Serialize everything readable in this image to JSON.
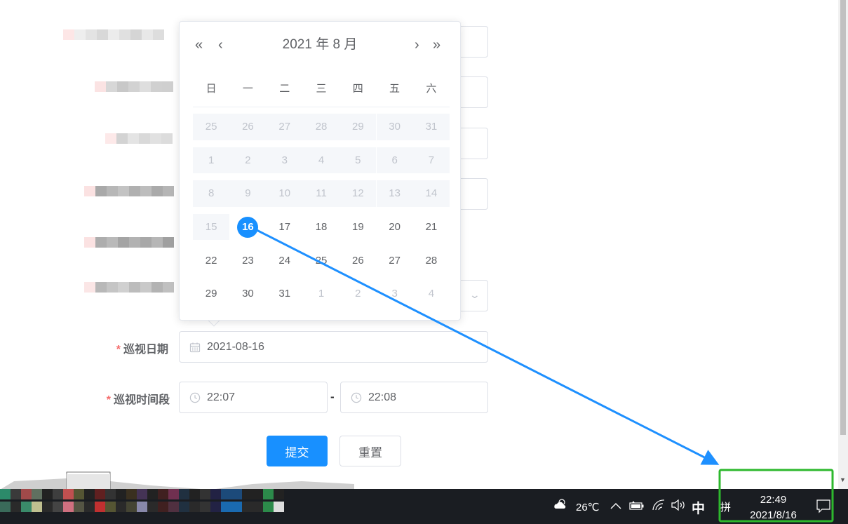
{
  "picker": {
    "title": "2021 年  8 月",
    "prev_year": "«",
    "prev_month": "‹",
    "next_month": "›",
    "next_year": "»",
    "weekdays": [
      "日",
      "一",
      "二",
      "三",
      "四",
      "五",
      "六"
    ],
    "weeks": [
      [
        "25",
        "26",
        "27",
        "28",
        "29",
        "30",
        "31"
      ],
      [
        "1",
        "2",
        "3",
        "4",
        "5",
        "6",
        "7"
      ],
      [
        "8",
        "9",
        "10",
        "11",
        "12",
        "13",
        "14"
      ],
      [
        "15",
        "16",
        "17",
        "18",
        "19",
        "20",
        "21"
      ],
      [
        "22",
        "23",
        "24",
        "25",
        "26",
        "27",
        "28"
      ],
      [
        "29",
        "30",
        "31",
        "1",
        "2",
        "3",
        "4"
      ]
    ],
    "today_label": "16"
  },
  "form": {
    "date_label": "巡视日期",
    "date_value": "2021-08-16",
    "time_label": "巡视时间段",
    "required_mark": "*",
    "time_start": "22:07",
    "time_separator": "-",
    "time_end": "22:08",
    "submit_label": "提交",
    "reset_label": "重置"
  },
  "taskbar": {
    "temperature": "26℃",
    "ime_mode": "中",
    "ime_icon": "拼",
    "time": "22:49",
    "date": "2021/8/16"
  },
  "colors": {
    "primary": "#1890ff",
    "annotation_arrow": "#1e90ff",
    "highlight_box": "#2db82d",
    "required": "#f56c6c"
  }
}
